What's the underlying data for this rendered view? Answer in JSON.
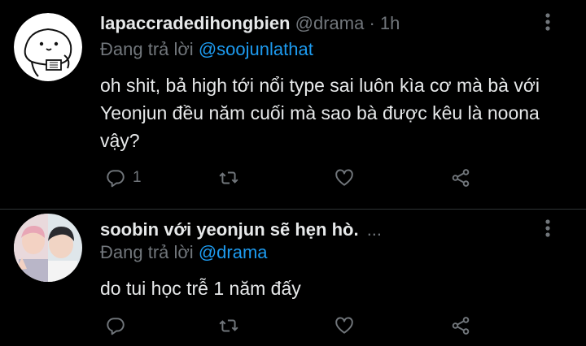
{
  "tweets": [
    {
      "name": "lapaccradedihongbien",
      "handle": "@drama",
      "dot": "·",
      "time": "1h",
      "replying_prefix": "Đang trả lời",
      "replying_to": "@soojunlathat",
      "text": "oh shit, bả high tới nổi type sai luôn kìa cơ mà bà với Yeonjun đều năm cuối mà sao bà được kêu là noona vậy?",
      "reply_count": "1",
      "retweet_count": "",
      "like_count": ""
    },
    {
      "name": "soobin với yeonjun sẽ hẹn hò.",
      "ellipsis": "...",
      "replying_prefix": "Đang trả lời",
      "replying_to": "@drama",
      "text": "do tui học trễ 1 năm đấy",
      "reply_count": "",
      "retweet_count": "",
      "like_count": ""
    }
  ],
  "icons": {
    "reply": "reply-icon",
    "retweet": "retweet-icon",
    "like": "heart-icon",
    "share": "share-icon",
    "more": "more-vertical-icon"
  },
  "colors": {
    "background": "#000000",
    "text": "#e7e9ea",
    "muted": "#71767b",
    "link": "#1d9bf0"
  }
}
